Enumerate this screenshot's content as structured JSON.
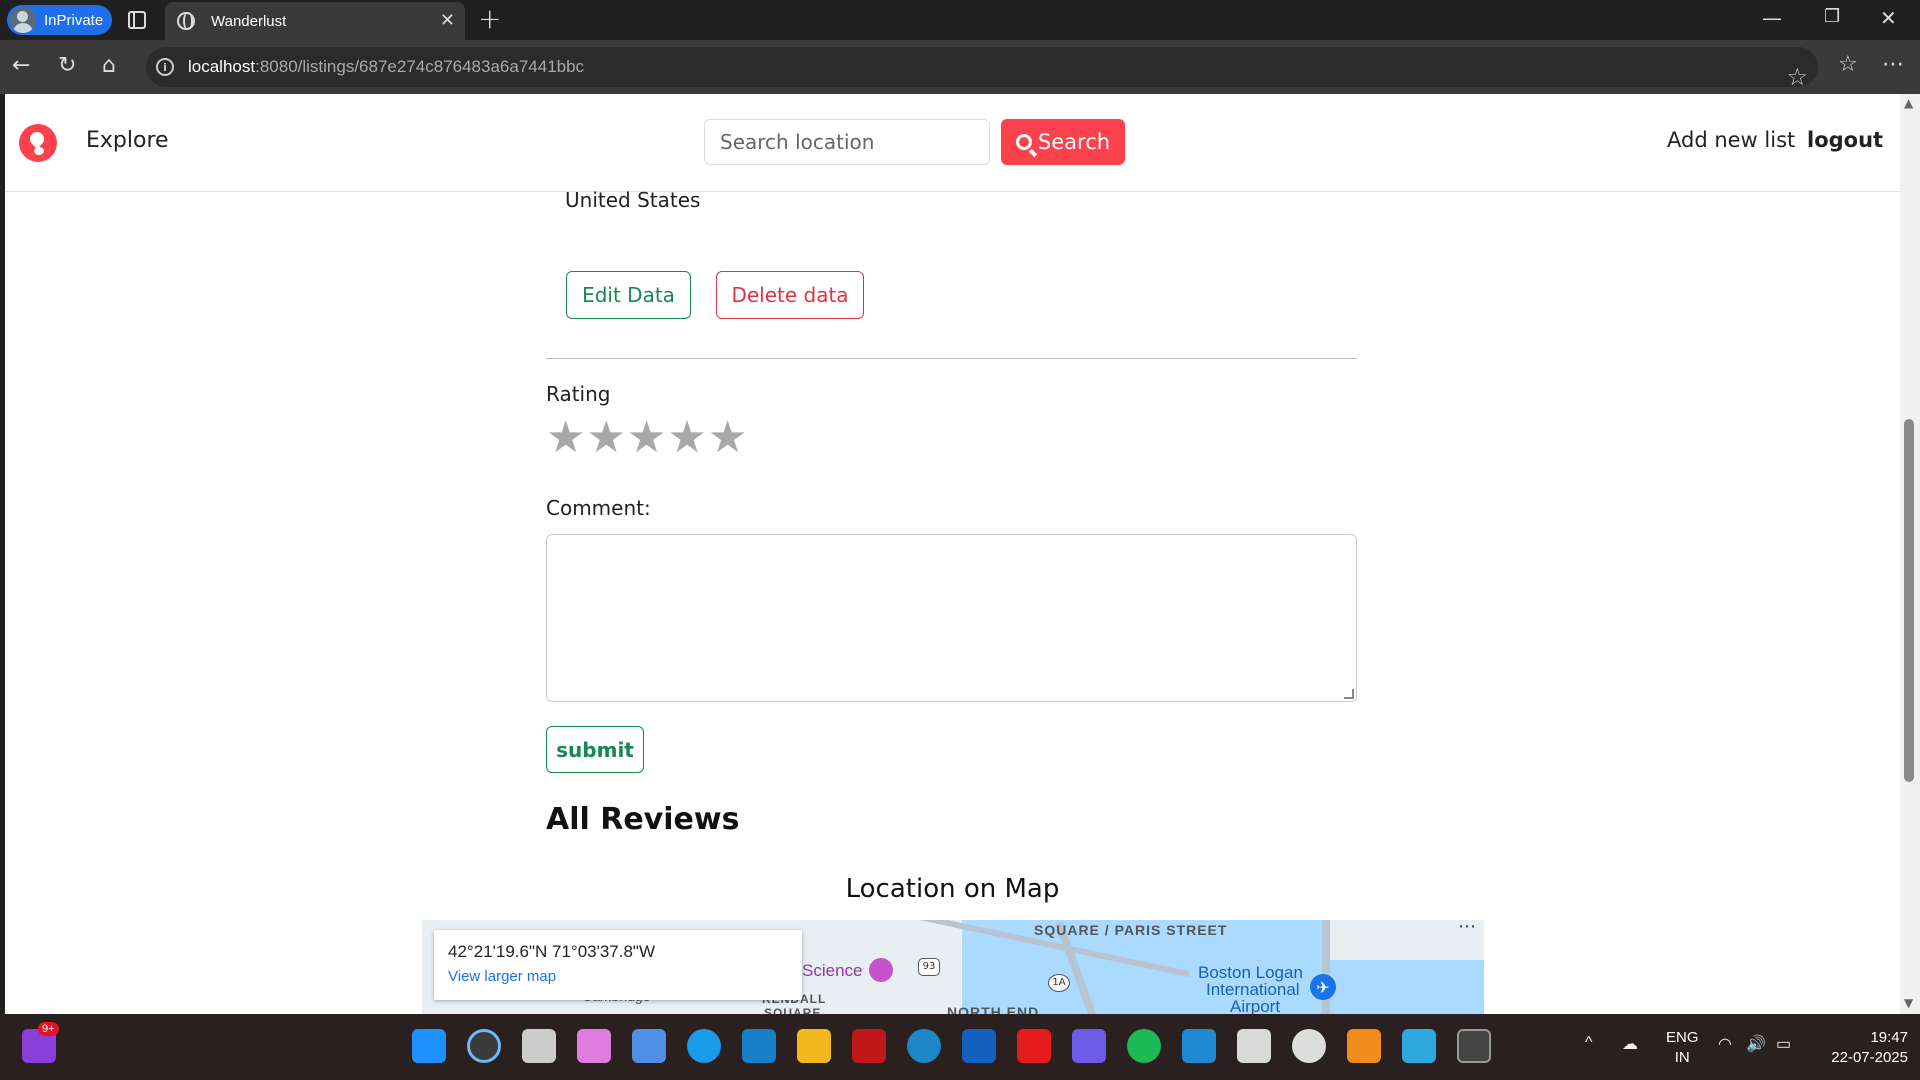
{
  "browser": {
    "inprivate_label": "InPrivate",
    "tab_title": "Wanderlust",
    "url_host": "localhost",
    "url_path": ":8080/listings/687e274c876483a6a7441bbc"
  },
  "navbar": {
    "brand": "Explore",
    "search_placeholder": "Search location",
    "search_button": "Search",
    "add_new_list": "Add new list",
    "logout": "logout"
  },
  "listing": {
    "country": "United States",
    "edit_button": "Edit Data",
    "delete_button": "Delete data"
  },
  "review_form": {
    "rating_label": "Rating",
    "rating_value": 0,
    "rating_max": 5,
    "comment_label": "Comment:",
    "comment_value": "",
    "submit_button": "submit"
  },
  "reviews": {
    "heading": "All Reviews"
  },
  "map": {
    "heading": "Location on Map",
    "coords": "42°21'19.6\"N 71°03'37.8\"W",
    "larger_map_link": "View larger map",
    "labels": {
      "square": "SQUARE / PARIS STREET",
      "science": "Science",
      "airport_1": "Boston Logan",
      "airport_2": "International",
      "airport_3": "Airport",
      "north_end": "NORTH END",
      "kendall": "KENDALL",
      "square2": "SQUARE",
      "cambridge": "Cambridge",
      "route_93": "93",
      "route_1a": "1A"
    }
  },
  "taskbar": {
    "notification_badge": "9+",
    "lang_1": "ENG",
    "lang_2": "IN",
    "time": "19:47",
    "date": "22-07-2025"
  },
  "colors": {
    "brand": "#fe424d",
    "success": "#198754",
    "danger": "#dc3545",
    "star_inactive": "#a8a8a8"
  }
}
